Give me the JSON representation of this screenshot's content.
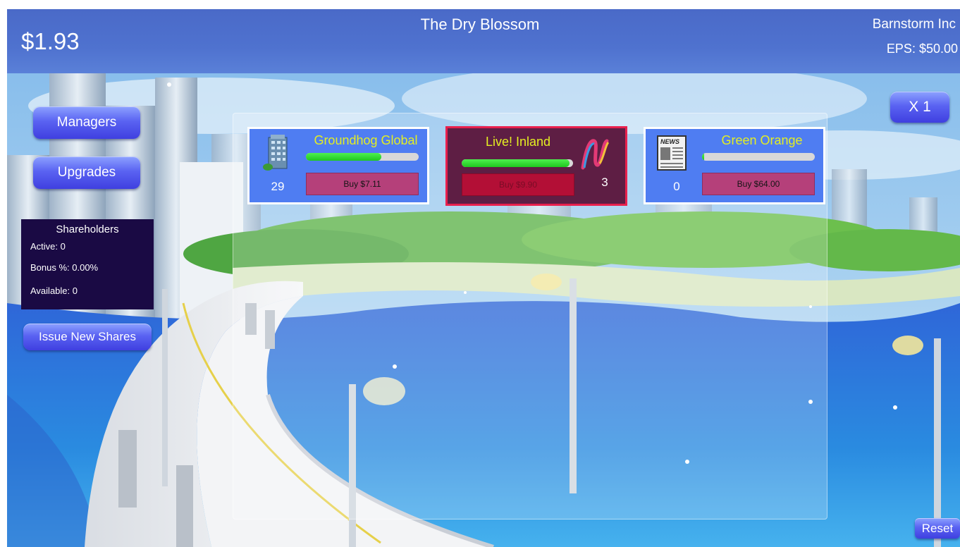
{
  "header": {
    "money": "$1.93",
    "company_title": "The Dry Blossom",
    "corporation_name": "Barnstorm Inc",
    "eps": "EPS: $50.00"
  },
  "multiplier_label": "X 1",
  "sidebar": {
    "managers_label": "Managers",
    "upgrades_label": "Upgrades",
    "issue_shares_label": "Issue New Shares"
  },
  "shareholders": {
    "title": "Shareholders",
    "active": "Active: 0",
    "bonus": "Bonus %: 0.00%",
    "available": "Available: 0"
  },
  "businesses": [
    {
      "name": "Groundhog Global",
      "count": "29",
      "buy_label": "Buy $7.11",
      "progress": 0.67,
      "icon": "office-building-icon",
      "state": "affordable"
    },
    {
      "name": "Live! Inland",
      "count": "3",
      "buy_label": "Buy $9.90",
      "progress": 0.97,
      "icon": "ribbon-logo-icon",
      "state": "unaffordable"
    },
    {
      "name": "Green Orange",
      "count": "0",
      "buy_label": "Buy $64.00",
      "progress": 0.02,
      "icon": "newspaper-icon",
      "state": "affordable"
    }
  ],
  "reset_label": "Reset",
  "colors": {
    "header_bar": "#4f72cf",
    "business_card": "#4f7df2",
    "business_card_locked": "#5e1e44",
    "locked_border": "#e8204d",
    "business_name": "#e3ee22",
    "progress_fill": "#2fd82f",
    "buy_button": "#b5407a",
    "buy_button_disabled": "#b30f36",
    "shareholders_panel": "#1a0a44"
  }
}
